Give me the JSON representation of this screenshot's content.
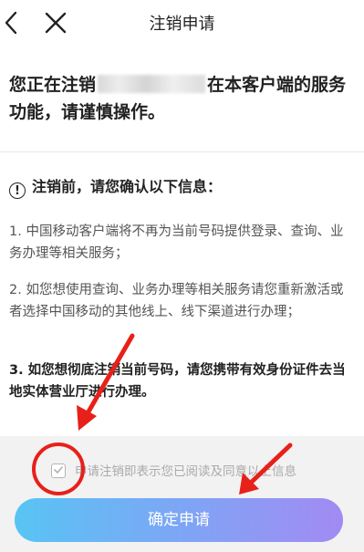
{
  "header": {
    "back_icon": "chevron-left-icon",
    "close_icon": "close-icon",
    "title": "注销申请"
  },
  "warning": {
    "prefix": "您正在注销",
    "suffix": "在本客户端的服务功能，请谨慎操作。"
  },
  "info": {
    "icon": "exclamation-circle-icon",
    "heading": "注销前，请您确认以下信息：",
    "items": [
      "1. 中国移动客户端将不再为当前号码提供登录、查询、业务办理等相关服务；",
      "2. 如您想使用查询、业务办理等相关服务请您重新激活或者选择中国移动的其他线上、线下渠道进行办理；",
      "3. 如您想彻底注销当前号码，请您携带有效身份证件去当地实体营业厅进行办理。"
    ]
  },
  "agreement": {
    "checked": true,
    "text": "申请注销即表示您已阅读及同意以上信息"
  },
  "confirm_button": {
    "label": "确定申请",
    "gradient": [
      "#58c4f4",
      "#a28af3"
    ]
  },
  "annotation_color": "#e8201a"
}
